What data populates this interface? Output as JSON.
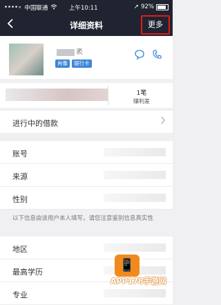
{
  "status_bar": {
    "signal": "••••∘",
    "carrier": "中国联通",
    "wifi_icon": "wifi-icon",
    "time": "上午10:11",
    "battery": "92%"
  },
  "navbar": {
    "back_icon": "chevron-left-icon",
    "title": "详细资料",
    "more_label": "更多"
  },
  "profile": {
    "name_visible_char": "袤",
    "badges": [
      "肖像",
      "银行卡"
    ],
    "chat_icon": "chat-bubble-icon",
    "phone_icon": "phone-icon"
  },
  "credit": {
    "count": "1笔",
    "label": "赚利差"
  },
  "loans": {
    "label": "进行中的借款",
    "icon": "chevron-right-icon"
  },
  "info_group": {
    "rows": [
      "账号",
      "来源",
      "性别"
    ]
  },
  "notice": {
    "text": "以下信息由该用户本人填写，请您注意鉴别信息真实性"
  },
  "info_group_2": {
    "rows": [
      "地区",
      "最高学历",
      "专业"
    ]
  },
  "watermark": {
    "text": "APP178手游网"
  }
}
